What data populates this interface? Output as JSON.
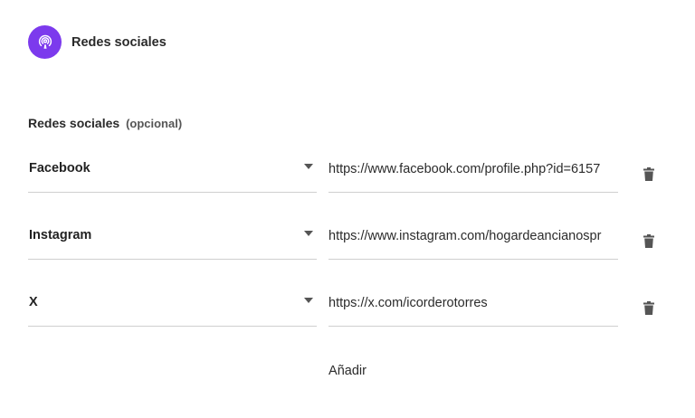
{
  "header": {
    "title": "Redes sociales",
    "icon": "broadcast-icon",
    "icon_bg": "#7c3aed"
  },
  "field": {
    "label": "Redes sociales",
    "optional": "(opcional)"
  },
  "rows": [
    {
      "network": "Facebook",
      "url": "https://www.facebook.com/profile.php?id=6157"
    },
    {
      "network": "Instagram",
      "url": "https://www.instagram.com/hogardeancianospr"
    },
    {
      "network": "X",
      "url": "https://x.com/icorderotorres"
    }
  ],
  "add_label": "Añadir",
  "icons": {
    "dropdown": "caret-down-icon",
    "delete": "trash-icon"
  }
}
